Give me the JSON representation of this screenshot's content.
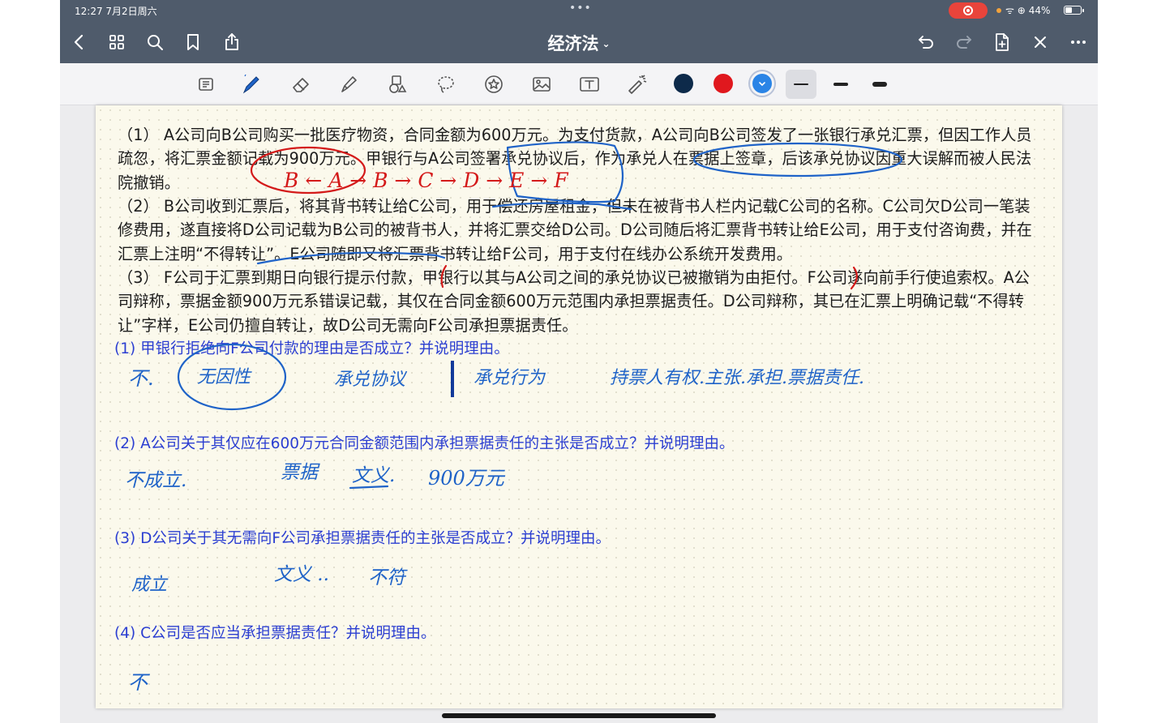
{
  "status_bar": {
    "time": "12:27  7月2日周六",
    "dots": "•••",
    "battery": "44%"
  },
  "nav": {
    "title": "经济法",
    "title_chevron": "⌄"
  },
  "colors": {
    "nav_bg": "#4f5b6b",
    "ink_blue": "#1f63c8",
    "ink_red": "#d41a1a",
    "question_blue": "#2b3ed1",
    "swatch_navy": "#0d2a4a",
    "swatch_red": "#e0181e",
    "swatch_blue": "#2a84e6"
  },
  "toolbar": {
    "tools": [
      "read-mode-icon",
      "pen-icon",
      "eraser-icon",
      "highlighter-icon",
      "shapes-icon",
      "lasso-icon",
      "sticker-icon",
      "image-icon",
      "text-icon",
      "laser-pointer-icon"
    ],
    "selected_tool": "pen-icon",
    "selected_color": "swatch_blue",
    "selected_stroke": "thin"
  },
  "document": {
    "paragraphs": [
      "（1） A公司向B公司购买一批医疗物资，合同金额为600万元。为支付货款，A公司向B公司签发了一张银行承兑汇票，但因工作人员疏忽，将汇票金额记载为900万元。甲银行与A公司签署承兑协议后，作为承兑人在票据上签章，后该承兑协议因重大误解而被人民法院撤销。",
      "（2） B公司收到汇票后，将其背书转让给C公司，用于偿还房屋租金，但未在被背书人栏内记载C公司的名称。C公司欠D公司一笔装修费用，遂直接将D公司记载为B公司的被背书人，并将汇票交给D公司。D公司随后将汇票背书转让给E公司，用于支付咨询费，并在汇票上注明“不得转让”。E公司随即又将汇票背书转让给F公司，用于支付在线办公系统开发费用。",
      "（3） F公司于汇票到期日向银行提示付款，甲银行以其与A公司之间的承兑协议已被撤销为由拒付。F公司遂向前手行使追索权。A公司辩称，票据金额900万元系错误记载，其仅在合同金额600万元范围内承担票据责任。D公司辩称，其已在汇票上明确记载“不得转让”字样，E公司仍擅自转让，故D公司无需向F公司承担票据责任。"
    ],
    "questions": [
      "(1) 甲银行拒绝向F公司付款的理由是否成立？并说明理由。",
      "(2) A公司关于其仅应在600万元合同金额范围内承担票据责任的主张是否成立？并说明理由。",
      "(3) D公司关于其无需向F公司承担票据责任的主张是否成立？并说明理由。",
      "(4) C公司是否应当承担票据责任？并说明理由。"
    ]
  },
  "handwriting": {
    "chain": "B ← A → B → C → D → E → F",
    "a1": [
      "不.",
      "无因性",
      "承兑协议",
      "承兑行为",
      "持票人有权.主张.承担.票据责任."
    ],
    "a2": [
      "不成立.",
      "票据",
      "文义.",
      "900万元"
    ],
    "a3": [
      "成立",
      "文义 ..",
      "不符"
    ],
    "a4": [
      "不"
    ]
  }
}
